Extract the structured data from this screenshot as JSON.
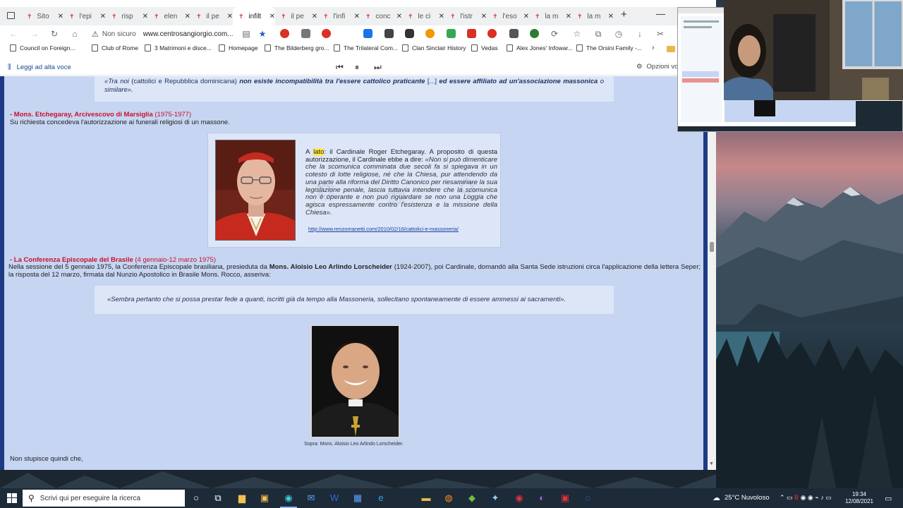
{
  "browser": {
    "tabs": [
      {
        "label": "Sito"
      },
      {
        "label": "l'epi"
      },
      {
        "label": "risp"
      },
      {
        "label": "elen"
      },
      {
        "label": "il pe"
      },
      {
        "label": "infilt",
        "active": true
      },
      {
        "label": "il pe"
      },
      {
        "label": "l'infi"
      },
      {
        "label": "conc"
      },
      {
        "label": "le ci"
      },
      {
        "label": "l'istr"
      },
      {
        "label": "l'eso"
      },
      {
        "label": "la m"
      },
      {
        "label": "la m"
      }
    ],
    "new_tab": "+",
    "minimize": "—",
    "address": {
      "security_label": "Non sicuro",
      "url": "www.centrosangiorgio.com..."
    },
    "bookmarks": [
      "Council on Foreign...",
      "Club of Rome",
      "3 Matrimoni e disce...",
      "Homepage",
      "The Bilderberg gro...",
      "The Trilateral Com...",
      "Clan Sinclair History",
      "Vedas",
      "Alex Jones' Infowar...",
      "The Orsini Family -..."
    ],
    "bookmarks_more": "›",
    "read_aloud": {
      "label": "Leggi ad alta voce",
      "options": "Opzioni vo"
    }
  },
  "article": {
    "quote1": {
      "p1": "«Tra noi",
      "p2": " (cattolici e Repubblica dominicana) ",
      "p3": "non esiste incompatibilità tra l'essere cattolico praticante",
      "p4": " [...] ",
      "p5": "ed essere affiliato ad un'associazione massonica",
      "p6": " o similare»."
    },
    "section1": {
      "title": "- Mons. Etchegaray, Arcivescovo di Marsiglia",
      "dates": " (1975-1977)",
      "text": "Su richiesta concedeva l'autorizzazione ai funerali religiosi di un massone."
    },
    "etchegaray_box": {
      "lead": "A ",
      "highlight": "lato",
      "text": ": il Cardinale Roger Etchegaray. A proposito di questa autorizzazione, il Cardinale ebbe a dire: ",
      "quote": "«Non si può dimenticare che la scomunica comminata due secoli fa si spiegava in un cotesto di lotte religiose, né che la Chiesa, pur attendendo da una parte alla riforma del Diritto Canonico per riesaminare la sua legislazione penale, lascia tuttavia intendere che la scomunica non è operante e non può riguardare se non una Loggia che agisca espressamente contro l'esistenza e la missione della Chiesa».",
      "link": "http://www.renzomanetti.com/2010/02/16/cattolici-e-massoneria/"
    },
    "section2": {
      "title": "- La Conferenza Episcopale del Brasile",
      "dates": " (4 gennaio-12 marzo 1975)",
      "text_a": "Nella sessione del 5 gennaio 1975, la Conferenza Episcopale brasiliana, presieduta da ",
      "text_bold": "Mons. Aloisio Leo Arlindo Lorscheider",
      "text_b": " (1924-2007), poi Cardinale, domandò alla Santa Sede istruzioni circa l'applicazione della lettera Seper; la risposta del 12 marzo, firmata dal Nunzio Apostolico in Brasile Mons. Rocco, asseriva:"
    },
    "quote2": "«Sembra pertanto che si possa prestar fede a quanti, iscritti già da tempo alla Massoneria, sollecitano spontaneamente di essere ammessi ai sacramenti».",
    "photo_caption": "Sopra: Mons. Aloisio Leo Arlindo Lorscheider.",
    "outro": "Non stupisce quindi che,"
  },
  "taskbar": {
    "search_placeholder": "Scrivi qui per eseguire la ricerca",
    "weather": "25°C  Nuvoloso",
    "time": "19:34",
    "date": "12/08/2021"
  },
  "colors": {
    "page_bg": "#c6d5f1",
    "page_border": "#1d3b84",
    "section_title": "#c8102e",
    "highlight": "#ffe94a"
  }
}
